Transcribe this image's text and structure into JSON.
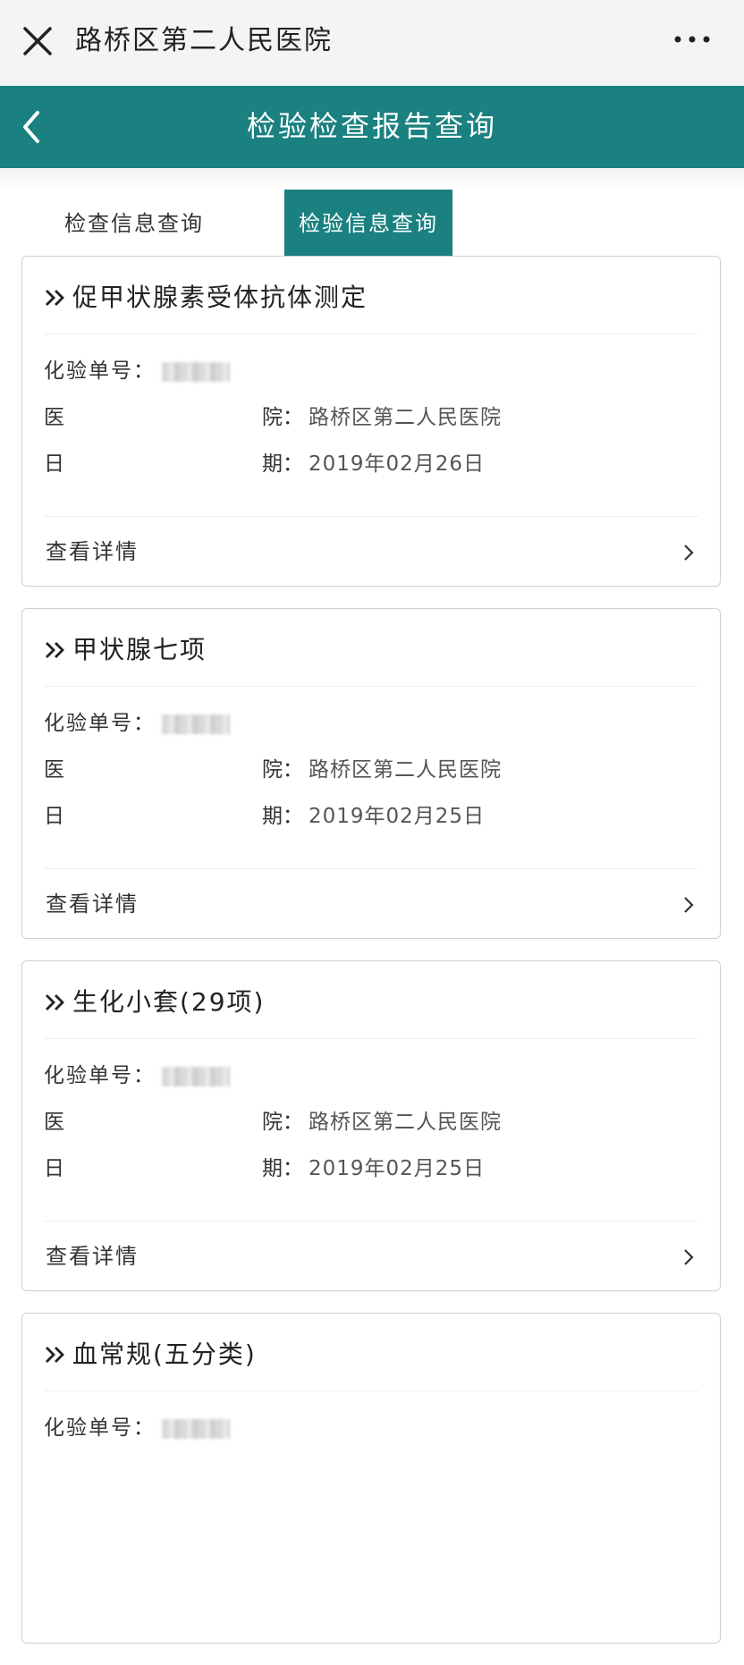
{
  "wx": {
    "title": "路桥区第二人民医院"
  },
  "header": {
    "title": "检验检查报告查询"
  },
  "tabs": [
    {
      "label": "检查信息查询",
      "active": false
    },
    {
      "label": "检验信息查询",
      "active": true
    }
  ],
  "labels": {
    "order_no": "化验单号：",
    "hospital_left": "医",
    "hospital_right": "院：",
    "date_left": "日",
    "date_right": "期：",
    "detail": "查看详情"
  },
  "reports": [
    {
      "title": "促甲状腺素受体抗体测定",
      "hospital": "路桥区第二人民医院",
      "date": "2019年02月26日"
    },
    {
      "title": "甲状腺七项",
      "hospital": "路桥区第二人民医院",
      "date": "2019年02月25日"
    },
    {
      "title": "生化小套(29项)",
      "hospital": "路桥区第二人民医院",
      "date": "2019年02月25日"
    },
    {
      "title": "血常规(五分类)",
      "hospital": "",
      "date": ""
    }
  ],
  "colors": {
    "teal": "#1a8080",
    "text": "#333333",
    "border": "#cfcfcf"
  },
  "icons": {
    "close": "close-icon",
    "more": "more-dots-icon",
    "back": "chevron-left-icon",
    "title_marker": "double-chevron-right-icon",
    "detail_arrow": "chevron-right-icon"
  }
}
